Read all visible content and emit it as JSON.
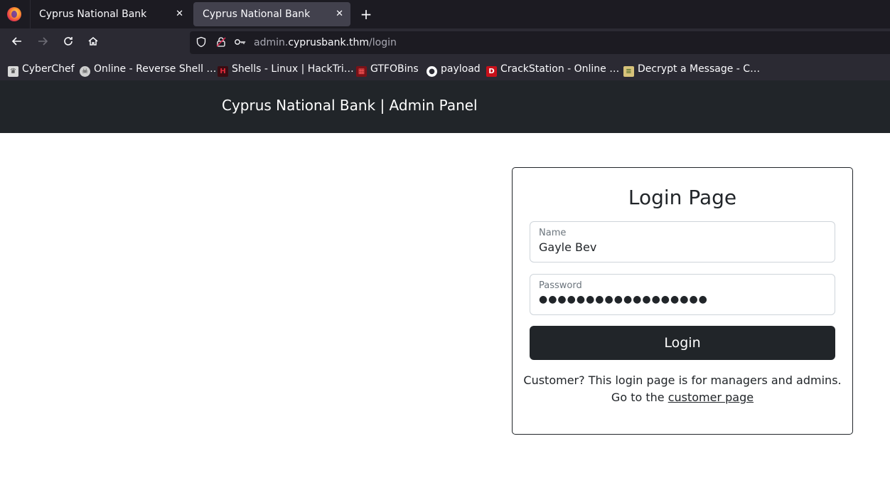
{
  "browser": {
    "tabs": [
      {
        "title": "Cyprus National Bank",
        "close": "✕"
      },
      {
        "title": "Cyprus National Bank",
        "close": "✕"
      }
    ],
    "new_tab": "+",
    "url_prefix": "admin.",
    "url_host": "cyprusbank.thm",
    "url_path": "/login",
    "bookmarks": [
      {
        "label": "CyberChef",
        "icon": "chef-icon"
      },
      {
        "label": "Online - Reverse Shell …",
        "icon": "skull-icon"
      },
      {
        "label": "Shells - Linux | HackTri…",
        "icon": "hacktricks-icon"
      },
      {
        "label": "GTFOBins",
        "icon": "gtfobins-icon"
      },
      {
        "label": "payload",
        "icon": "github-icon"
      },
      {
        "label": "CrackStation - Online …",
        "icon": "crackstation-icon"
      },
      {
        "label": "Decrypt a Message - C…",
        "icon": "decrypt-icon"
      }
    ]
  },
  "header": {
    "title": "Cyprus National Bank | Admin Panel"
  },
  "login": {
    "title": "Login Page",
    "name_label": "Name",
    "name_value": "Gayle Bev",
    "password_label": "Password",
    "password_value": "●●●●●●●●●●●●●●●●●●",
    "button_label": "Login",
    "info_line1": "Customer? This login page is for managers and admins.",
    "info_prefix": "Go to the ",
    "info_link": "customer page"
  },
  "colors": {
    "header_bg": "#212529",
    "button_bg": "#212529",
    "chrome_dark": "#1c1b22",
    "chrome_mid": "#2b2a33"
  }
}
